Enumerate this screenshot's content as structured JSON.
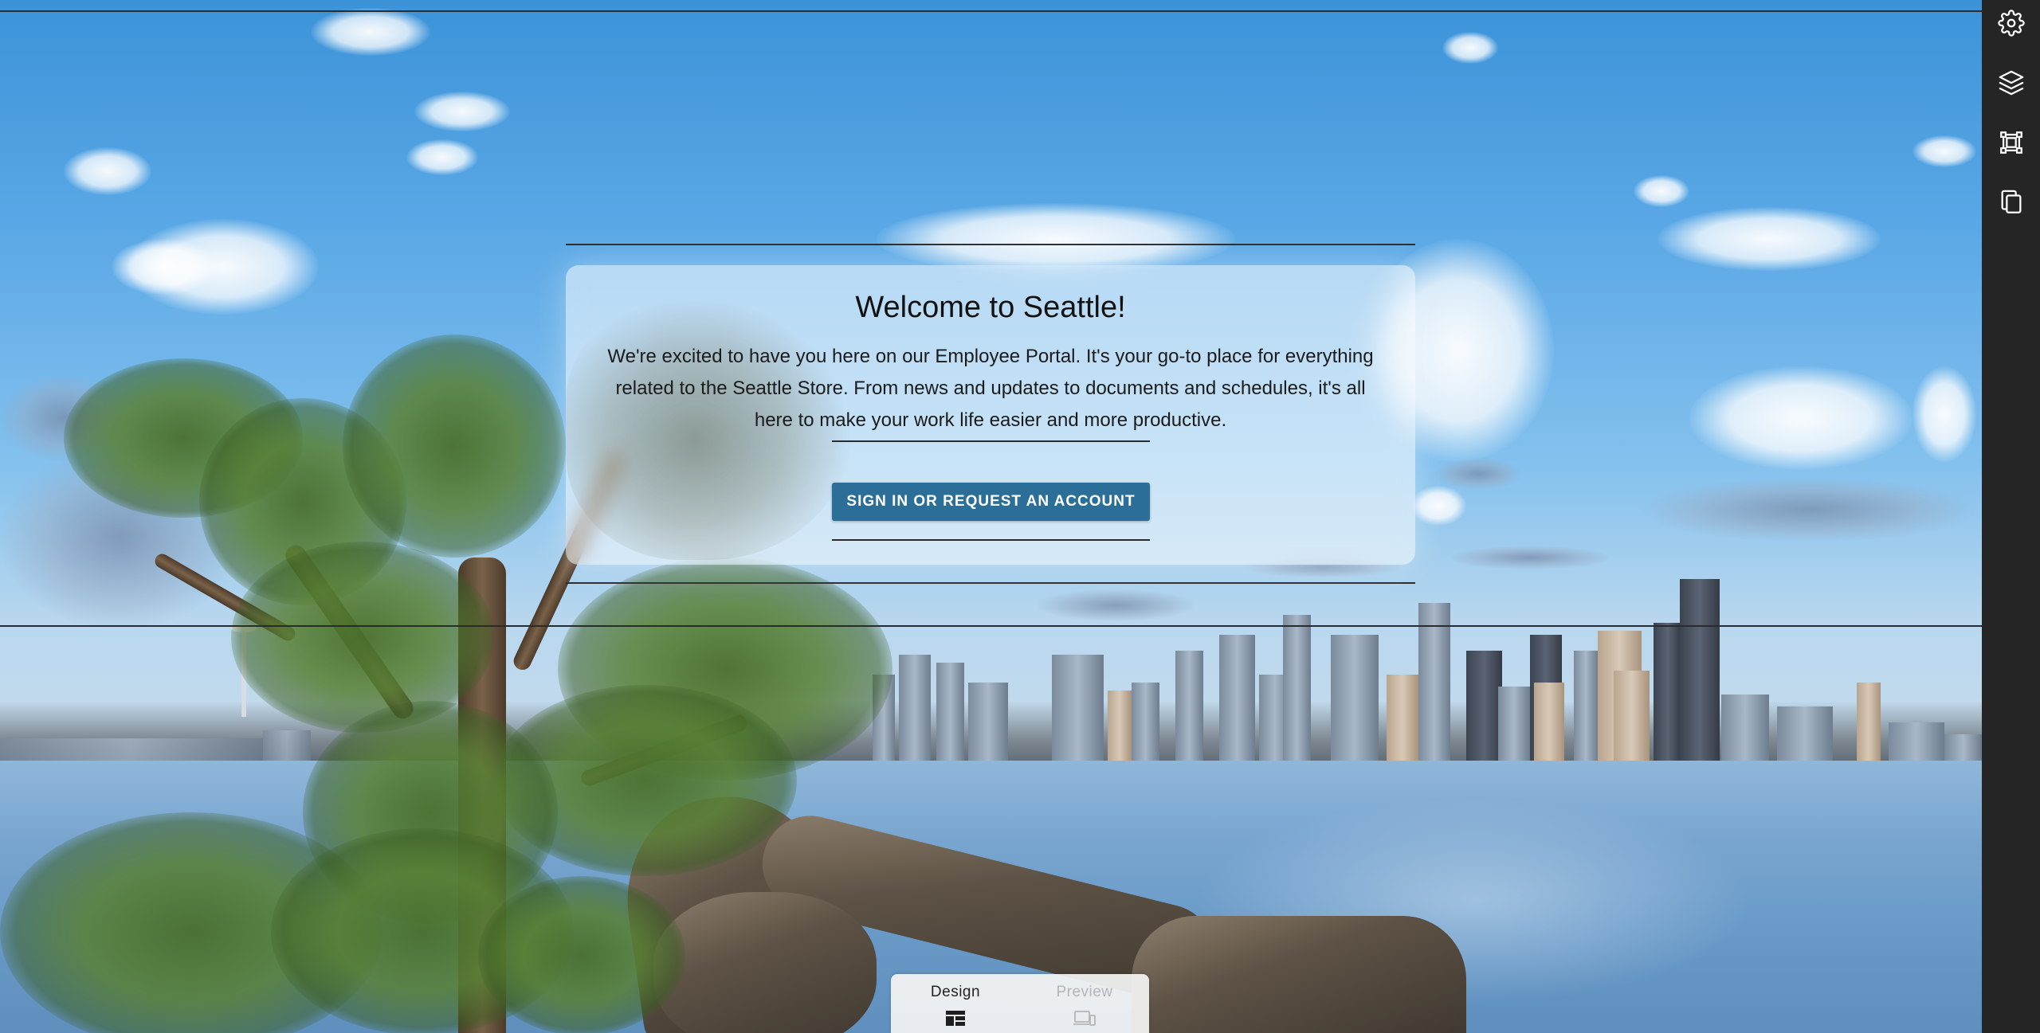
{
  "welcome_card": {
    "title": "Welcome to Seattle!",
    "body_lines": [
      "We're excited to have you here on our Employee Portal. It's your go-to place for everything",
      "related to the Seattle Store. From news and updates to documents and schedules, it's all",
      "here to make your work life easier and more productive."
    ],
    "button_label": "SIGN IN OR REQUEST AN ACCOUNT"
  },
  "toolbar": {
    "items": [
      {
        "icon": "gear-icon",
        "name": "settings"
      },
      {
        "icon": "layers-icon",
        "name": "layers"
      },
      {
        "icon": "frame-select-icon",
        "name": "frame"
      },
      {
        "icon": "copy-icon",
        "name": "copy"
      }
    ]
  },
  "mode_switcher": {
    "design_label": "Design",
    "preview_label": "Preview",
    "active": "Design"
  },
  "colors": {
    "button": "#2b6f98",
    "toolbar": "#252525",
    "guide_line": "#2b2b2b"
  }
}
